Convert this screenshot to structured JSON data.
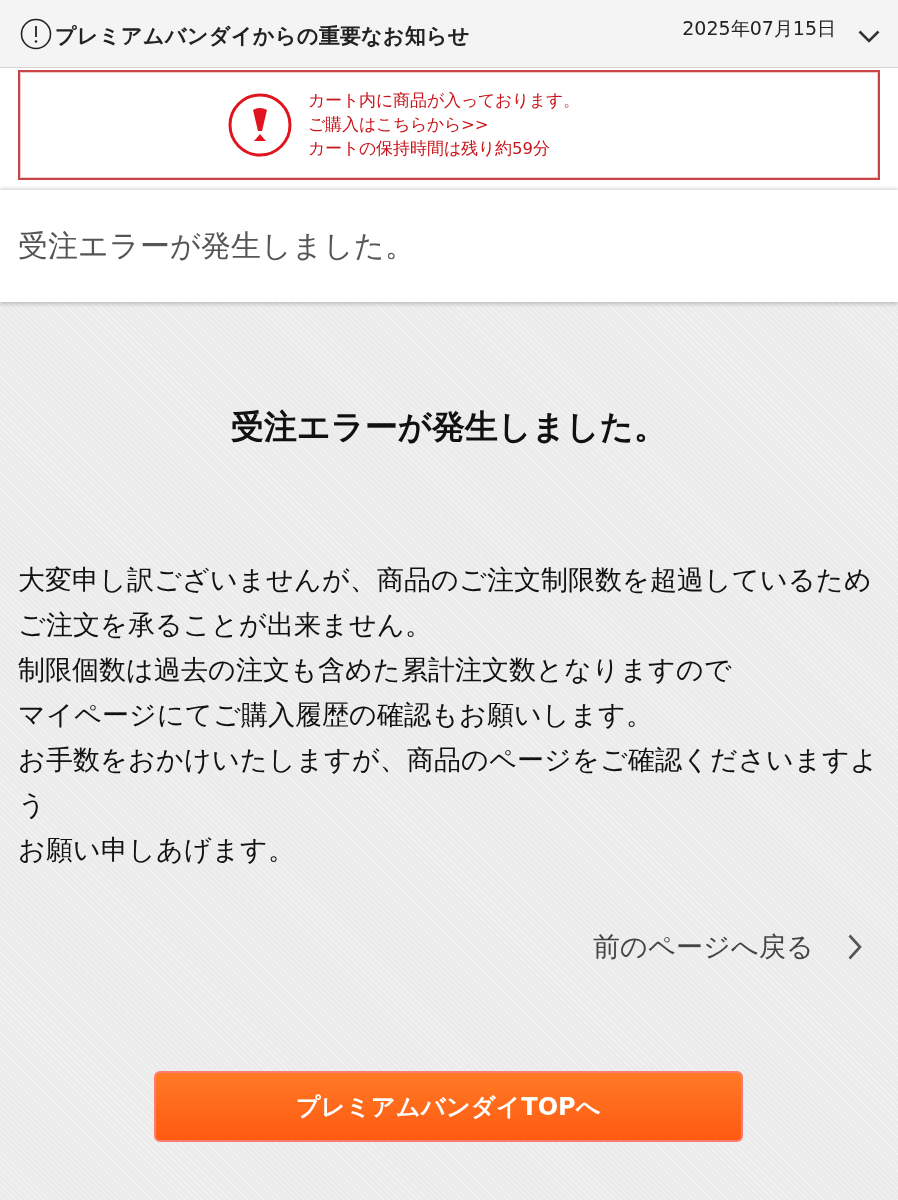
{
  "notice_bar": {
    "title": "プレミアムバンダイからの重要なお知らせ",
    "date": "2025年07月15日",
    "expanded": false
  },
  "cart_alert": {
    "message": "カート内に商品が入っております。",
    "purchase_link": "ご購入はこちらから>>",
    "hold_time": "カートの保持時間は残り約59分"
  },
  "page_title": "受注エラーが発生しました。",
  "error": {
    "heading": "受注エラーが発生しました。",
    "message_lines": [
      "大変申し訳ございませんが、商品のご注文制限数を超過しているため",
      "ご注文を承ることが出来ません。",
      "制限個数は過去の注文も含めた累計注文数となりますので",
      "マイページにてご購入履歴の確認もお願いします。",
      "お手数をおかけいたしますが、商品のページをご確認くださいますよう",
      "お願い申しあげます。"
    ]
  },
  "back_link": "前のページへ戻る",
  "top_button": "プレミアムバンダイTOPへ"
}
